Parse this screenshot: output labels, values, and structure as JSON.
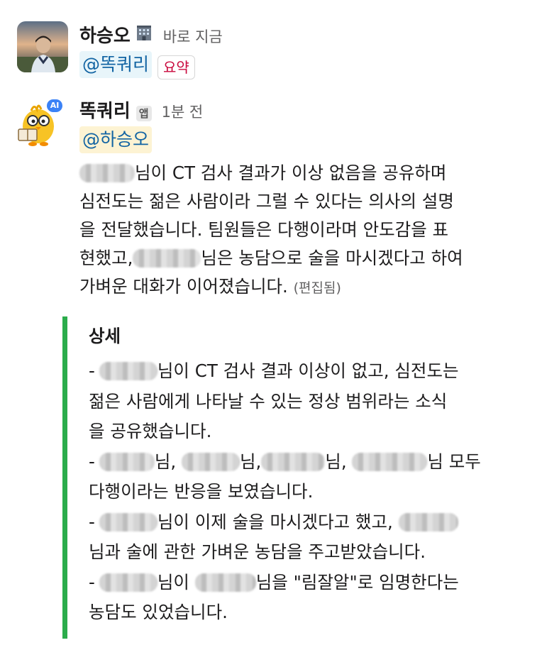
{
  "messages": [
    {
      "sender": "하승오",
      "sender_icon": "building-icon",
      "timestamp": "바로 지금",
      "mention": "@똑쿼리",
      "summary_button": "요약"
    },
    {
      "sender": "똑쿼리",
      "badge": "앱",
      "timestamp": "1분 전",
      "mention": "@하승오",
      "body": {
        "line1": "님이 CT 검사 결과가 이상 없음을 공유하며",
        "line2": "심전도는 젊은 사람이라 그럴 수 있다는 의사의 설명",
        "line3": "을 전달했습니다. 팀원들은 다행이라며 안도감을 표",
        "line4_a": "현했고,",
        "line4_b": "님은 농담으로 술을 마시겠다고 하여",
        "line5": "가벼운 대화가 이어졌습니다.",
        "edited": "(편집됨)"
      },
      "detail": {
        "heading": "상세",
        "b1_l1": "님이 CT 검사 결과 이상이 없고, 심전도는",
        "b1_l2": "젊은 사람에게 나타날 수 있는 정상 범위라는 소식",
        "b1_l3": "을 공유했습니다.",
        "b2_n1": "님,",
        "b2_n2": "님,",
        "b2_n3": "님,",
        "b2_n4": "님 모두",
        "b2_l2": "다행이라는 반응을 보였습니다.",
        "b3_l1": "님이 이제 술을 마시겠다고 했고,",
        "b3_l2": "님과 술에 관한 가벼운 농담을 주고받았습니다.",
        "b4_l1": "님을 \"림잘알\"로 임명한다는",
        "b4_l2": "농담도 있었습니다.",
        "dash": "-"
      }
    }
  ],
  "colors": {
    "mention_text": "#1264a3",
    "mention_bg": "#e8f5fa",
    "mention_bg_highlight": "#fdf3d3",
    "summary_text": "#c9093d",
    "quote_bar": "#2bac4b"
  }
}
